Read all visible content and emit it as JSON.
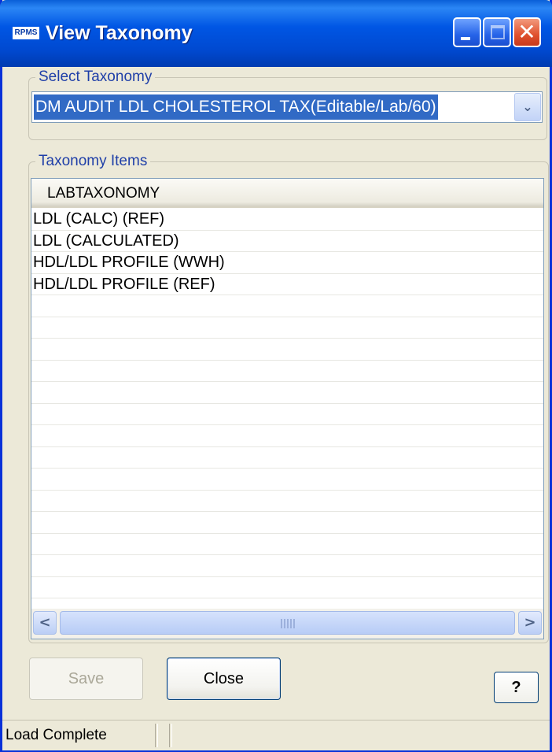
{
  "window": {
    "title": "View Taxonomy",
    "app_icon_text": "RPMS",
    "controls": {
      "minimize": "minimize",
      "maximize": "maximize",
      "close": "✕"
    }
  },
  "select_taxonomy": {
    "group_label": "Select Taxonomy",
    "selected_value": "DM AUDIT LDL CHOLESTEROL TAX(Editable/Lab/60)",
    "dropdown_glyph": "⌄"
  },
  "taxonomy_items": {
    "group_label": "Taxonomy Items",
    "column_header": "LABTAXONOMY",
    "rows": [
      "LDL (CALC) (REF)",
      "LDL (CALCULATED)",
      "HDL/LDL PROFILE (WWH)",
      "HDL/LDL PROFILE (REF)",
      "",
      "",
      "",
      "",
      "",
      "",
      "",
      "",
      "",
      "",
      "",
      "",
      "",
      ""
    ],
    "scroll_left_glyph": "<",
    "scroll_right_glyph": ">"
  },
  "buttons": {
    "save": "Save",
    "close": "Close",
    "help": "?"
  },
  "status": {
    "text": "Load Complete"
  },
  "colors": {
    "titlebar": "#0A5FD8",
    "selection": "#316AC5",
    "group_label": "#1F3FA8",
    "window_bg": "#ECE9D8"
  }
}
